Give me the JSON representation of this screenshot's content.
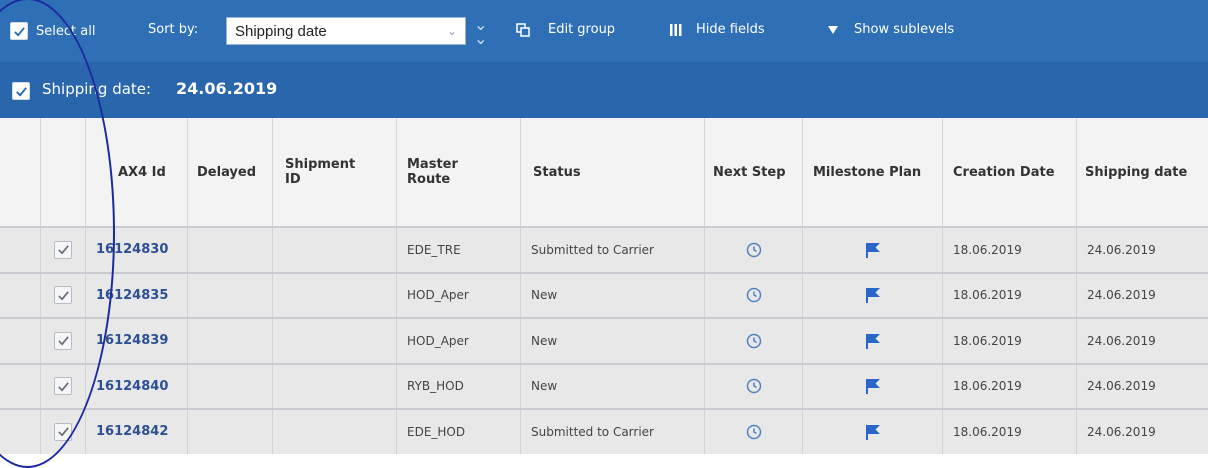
{
  "toolbar": {
    "select_all_label": "Select all",
    "sort_by_label": "Sort by:",
    "sort_value": "Shipping date",
    "edit_group_label": "Edit group",
    "hide_fields_label": "Hide fields",
    "show_sublevels_label": "Show sublevels"
  },
  "group": {
    "label": "Shipping date:",
    "value": "24.06.2019"
  },
  "table": {
    "columns": {
      "ax4_id": "AX4 Id",
      "delayed": "Delayed",
      "shipment_id": "Shipment ID",
      "master_route": "Master Route",
      "status": "Status",
      "next_step": "Next Step",
      "milestone_plan": "Milestone Plan",
      "creation_date": "Creation Date",
      "shipping_date": "Shipping date"
    },
    "rows": [
      {
        "ax4_id": "16124830",
        "delayed": "",
        "shipment_id": "",
        "master_route": "EDE_TRE",
        "status": "Submitted to Carrier",
        "creation_date": "18.06.2019",
        "shipping_date": "24.06.2019"
      },
      {
        "ax4_id": "16124835",
        "delayed": "",
        "shipment_id": "",
        "master_route": "HOD_Aper",
        "status": "New",
        "creation_date": "18.06.2019",
        "shipping_date": "24.06.2019"
      },
      {
        "ax4_id": "16124839",
        "delayed": "",
        "shipment_id": "",
        "master_route": "HOD_Aper",
        "status": "New",
        "creation_date": "18.06.2019",
        "shipping_date": "24.06.2019"
      },
      {
        "ax4_id": "16124840",
        "delayed": "",
        "shipment_id": "",
        "master_route": "RYB_HOD",
        "status": "New",
        "creation_date": "18.06.2019",
        "shipping_date": "24.06.2019"
      },
      {
        "ax4_id": "16124842",
        "delayed": "",
        "shipment_id": "",
        "master_route": "EDE_HOD",
        "status": "Submitted to Carrier",
        "creation_date": "18.06.2019",
        "shipping_date": "24.06.2019"
      }
    ]
  },
  "colors": {
    "toolbar_bg": "#2f6fb5",
    "group_bg": "#2a66ab",
    "link": "#2d4f93",
    "annotation_oval": "#1a2a9c"
  },
  "icons": {
    "checkbox": "check-icon",
    "double_chevron": "double-chevron-down-icon",
    "edit_group": "copy-icon",
    "hide_fields": "columns-icon",
    "show_sublevels": "triangle-down-icon",
    "next_step": "clock-icon",
    "milestone_plan": "flag-icon"
  }
}
